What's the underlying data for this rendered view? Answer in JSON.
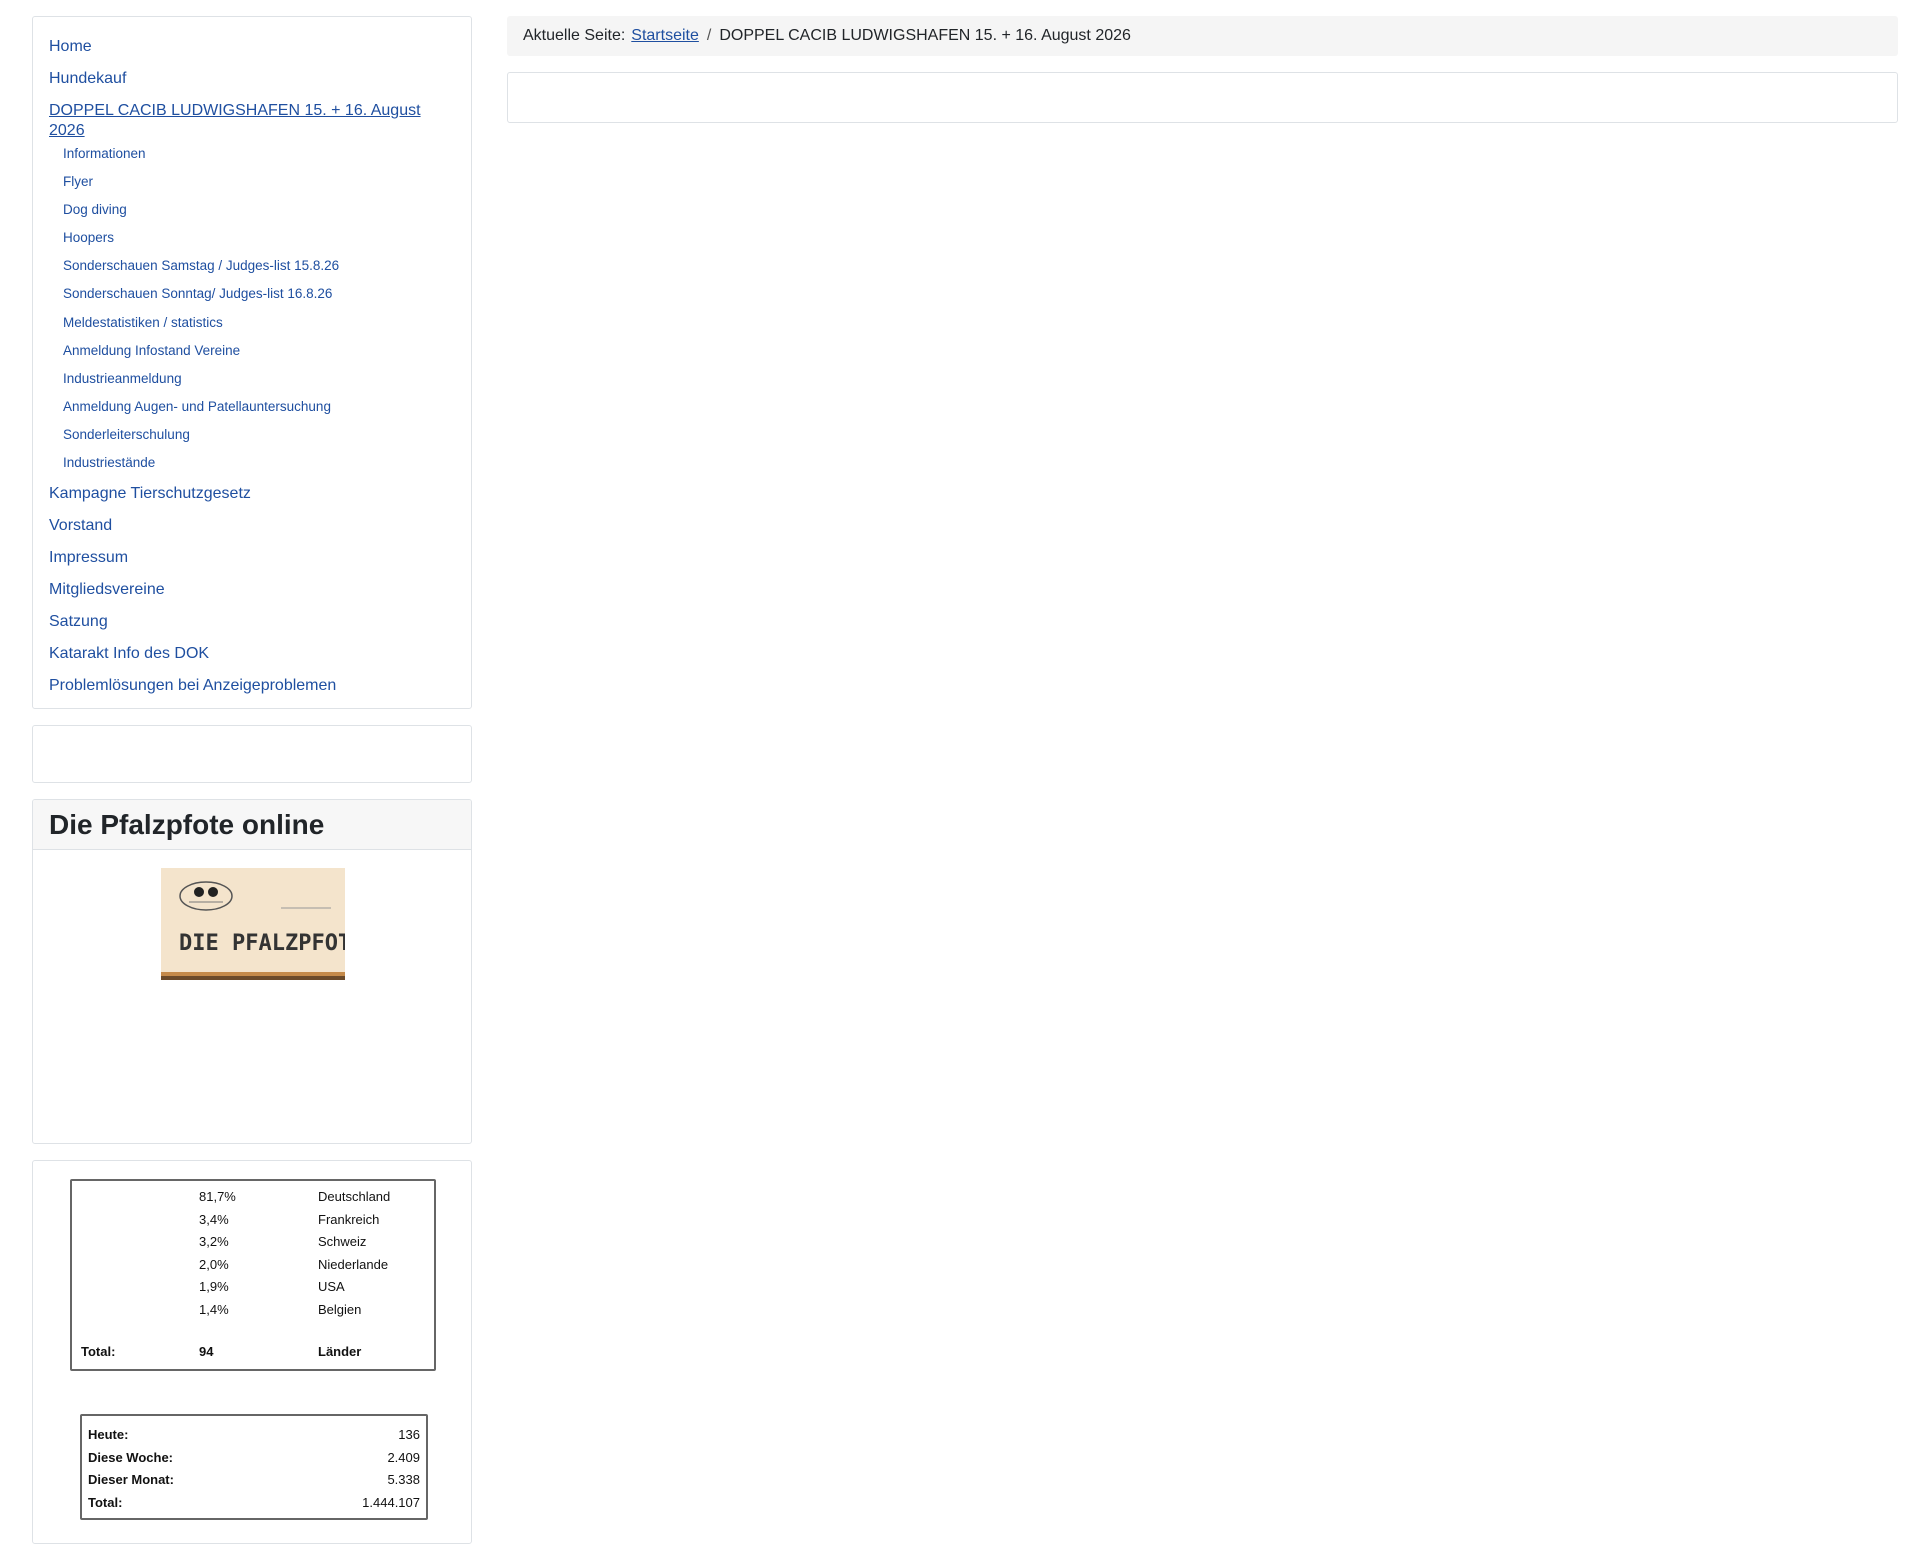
{
  "breadcrumb": {
    "prefix": "Aktuelle Seite:",
    "home_link": "Startseite",
    "separator": "/",
    "current": "DOPPEL CACIB LUDWIGSHAFEN 15. + 16. August 2026"
  },
  "menu": {
    "items": [
      {
        "label": "Home"
      },
      {
        "label": "Hundekauf"
      },
      {
        "label": "DOPPEL CACIB LUDWIGSHAFEN 15. + 16. August 2026",
        "active": true
      },
      {
        "label": "Kampagne Tierschutzgesetz"
      },
      {
        "label": "Vorstand"
      },
      {
        "label": "Impressum"
      },
      {
        "label": "Mitgliedsvereine"
      },
      {
        "label": "Satzung"
      },
      {
        "label": "Katarakt Info des DOK"
      },
      {
        "label": "Problemlösungen bei Anzeigeproblemen"
      }
    ],
    "submenu": [
      "Informationen",
      "Flyer",
      "Dog diving",
      "Hoopers",
      "Sonderschauen Samstag / Judges-list 15.8.26",
      "Sonderschauen Sonntag/ Judges-list 16.8.26",
      "Meldestatistiken / statistics",
      "Anmeldung Infostand Vereine",
      "Industrieanmeldung",
      "Anmeldung Augen- und Patellauntersuchung",
      "Sonderleiterschulung",
      "Industriestände"
    ]
  },
  "pfalzpfote": {
    "title": "Die Pfalzpfote online",
    "image_text": "DIE PFALZPFOTE"
  },
  "countries": {
    "rows": [
      {
        "pct": "81,7%",
        "name": "Deutschland"
      },
      {
        "pct": "3,4%",
        "name": "Frankreich"
      },
      {
        "pct": "3,2%",
        "name": "Schweiz"
      },
      {
        "pct": "2,0%",
        "name": "Niederlande"
      },
      {
        "pct": "1,9%",
        "name": "USA"
      },
      {
        "pct": "1,4%",
        "name": "Belgien"
      }
    ],
    "total_label": "Total:",
    "total_value": "94",
    "total_unit": "Länder"
  },
  "visitors": {
    "rows": [
      {
        "label": "Heute:",
        "value": "136"
      },
      {
        "label": "Diese Woche:",
        "value": "2.409"
      },
      {
        "label": "Dieser Monat:",
        "value": "5.338"
      },
      {
        "label": "Total:",
        "value": "1.444.107"
      }
    ]
  }
}
